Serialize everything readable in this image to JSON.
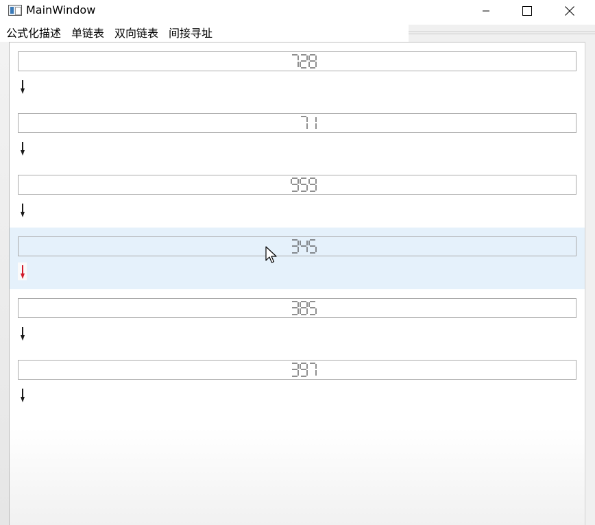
{
  "window": {
    "title": "MainWindow",
    "controls": [
      "minimize",
      "maximize",
      "close"
    ]
  },
  "menu": {
    "items": [
      "公式化描述",
      "单链表",
      "双向链表",
      "间接寻址"
    ]
  },
  "list": {
    "nodes": [
      {
        "value": "728",
        "arrow_color": "#1a1a1a",
        "selected": false
      },
      {
        "value": "71",
        "arrow_color": "#1a1a1a",
        "selected": false
      },
      {
        "value": "959",
        "arrow_color": "#1a1a1a",
        "selected": false
      },
      {
        "value": "345",
        "arrow_color": "#d11a2a",
        "selected": true
      },
      {
        "value": "385",
        "arrow_color": "#1a1a1a",
        "selected": false
      },
      {
        "value": "397",
        "arrow_color": "#1a1a1a",
        "selected": false
      }
    ]
  },
  "colors": {
    "selection_bg": "#e5f1fb",
    "lcd_digit": "#333333",
    "arrow_default": "#1a1a1a",
    "arrow_selected": "#d11a2a"
  }
}
